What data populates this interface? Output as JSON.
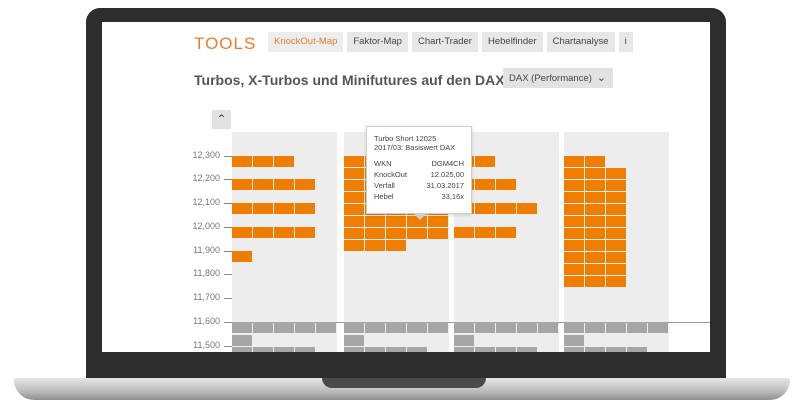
{
  "header": {
    "brand": "TOOLS",
    "tabs": [
      {
        "label": "KnockOut-Map",
        "active": true
      },
      {
        "label": "Faktor-Map",
        "active": false
      },
      {
        "label": "Chart-Trader",
        "active": false
      },
      {
        "label": "Hebelfinder",
        "active": false
      },
      {
        "label": "Chartanalyse",
        "active": false
      },
      {
        "label": "i",
        "active": false
      }
    ]
  },
  "main": {
    "title": "Turbos, X-Turbos und Minifutures auf den DAX (…",
    "underlying_select": "DAX (Performance)",
    "scroll_up_icon": "chevron-up-icon",
    "select_icon": "chevron-down-icon"
  },
  "map": {
    "y_labels": [
      "12,300",
      "12,200",
      "12,100",
      "12,000",
      "11,900",
      "11,800",
      "11,700",
      "11,600",
      "11,500"
    ],
    "reference_level": "11,600",
    "colors": {
      "bull": "#ef7d00",
      "bear": "#a6a6a6",
      "cell_bg": "#ededed",
      "accent": "#e87d2b"
    }
  },
  "tooltip": {
    "name": "Turbo Short 12025",
    "subtitle": "2017/03: Basiswert DAX",
    "rows": [
      {
        "label": "WKN",
        "value": "DGM4CH"
      },
      {
        "label": "KnockOut",
        "value": "12.025,00"
      },
      {
        "label": "Verfall",
        "value": "31.03.2017"
      },
      {
        "label": "Hebel",
        "value": "33,16x"
      }
    ]
  }
}
